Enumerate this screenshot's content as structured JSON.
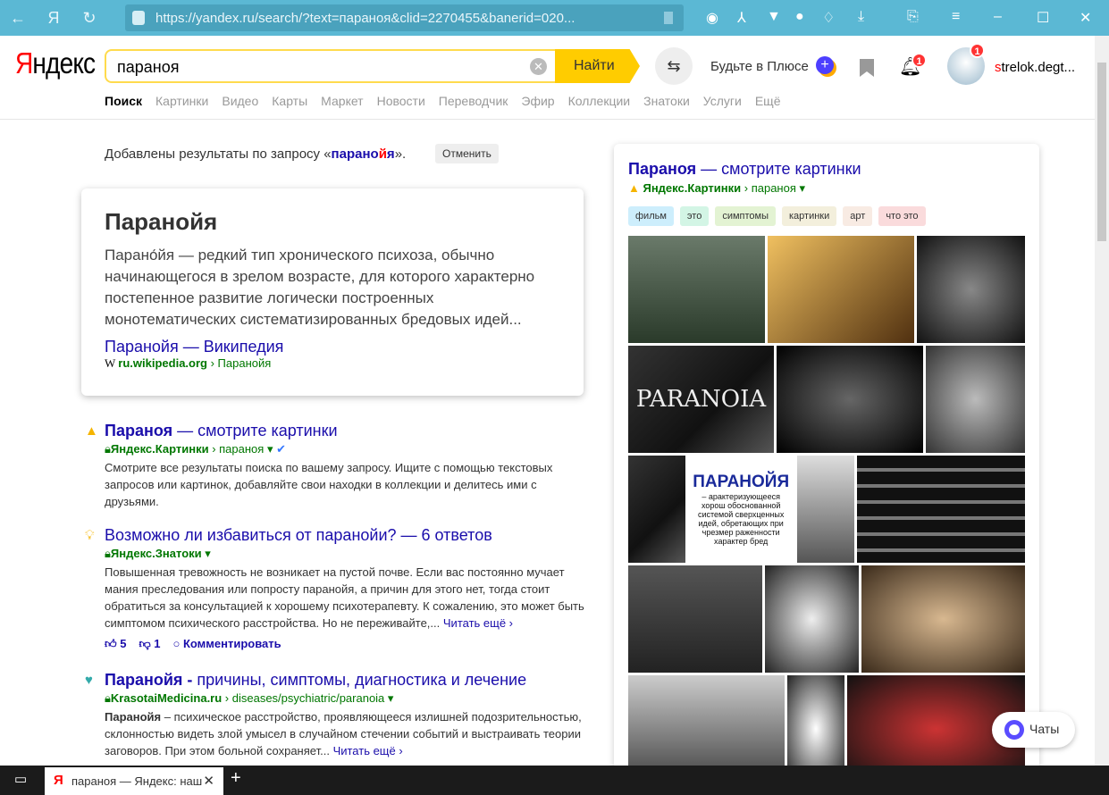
{
  "browser": {
    "url": "https://yandex.ru/search/?text=параноя&clid=2270455&banerid=020...",
    "tab_title": "параноя — Яндекс: наш"
  },
  "header": {
    "logo_first": "Я",
    "logo_rest": "ндекс",
    "query": "параноя",
    "find": "Найти",
    "plus": "Будьте в Плюсе",
    "notif_count": "1",
    "avatar_count": "1",
    "user_first": "s",
    "user_rest": "trelok.degt..."
  },
  "nav": [
    "Поиск",
    "Картинки",
    "Видео",
    "Карты",
    "Маркет",
    "Новости",
    "Переводчик",
    "Эфир",
    "Коллекции",
    "Знатоки",
    "Услуги",
    "Ещё"
  ],
  "notice": {
    "pre": "Добавлены результаты по запросу «",
    "q1": "парано",
    "q2": "й",
    "q3": "я",
    "post": "».",
    "cancel": "Отменить"
  },
  "wiki": {
    "title": "Паранойя",
    "text": "Парано́йя — редкий тип хронического психоза, обычно начинающегося в зрелом возрасте, для которого характерно постепенное развитие логически построенных монотематических систематизированных бредовых идей...",
    "link": "Паранойя — Википедия",
    "domain": "ru.wikipedia.org",
    "path": "Паранойя"
  },
  "results": [
    {
      "title_bold": "Параноя",
      "title": " — смотрите картинки",
      "site": "Яндекс.Картинки",
      "path": "параноя",
      "desc": "Смотрите все результаты поиска по вашему запросу. Ищите с помощью текстовых запросов или картинок, добавляйте свои находки в коллекции и делитесь ими с друзьями."
    },
    {
      "title": "Возможно ли избавиться от паранойи? — 6 ответов",
      "site": "Яндекс.Знатоки",
      "desc": "Повышенная тревожность не возникает на пустой почве. Если вас постоянно мучает мания преследования или попросту паранойя, а причин для этого нет, тогда стоит обратиться за консультацией к хорошему психотерапевту. К сожалению, это может быть симптомом психического расстройства. Но не переживайте,...",
      "more": "Читать ещё ›",
      "likes": "5",
      "dislikes": "1",
      "comment": "Комментировать"
    },
    {
      "title_bold": "Паранойя -",
      "title": " причины, симптомы, диагностика и лечение",
      "site": "KrasotaiMedicina.ru",
      "path": "diseases/psychiatric/paranoia",
      "desc_bold": "Паранойя",
      "desc": " – психическое расстройство, проявляющееся излишней подозрительностью, склонностью видеть злой умысел в случайном стечении событий и выстраивать теории заговоров. При этом больной сохраняет...",
      "more": "Читать ещё ›"
    }
  ],
  "images_panel": {
    "title_bold": "Параноя",
    "title": " — смотрите картинки",
    "site": "Яндекс.Картинки",
    "path": "параноя",
    "tags": [
      {
        "label": "фильм",
        "color": "#cdeefc"
      },
      {
        "label": "это",
        "color": "#d3f5e5"
      },
      {
        "label": "симптомы",
        "color": "#e3f3d3"
      },
      {
        "label": "картинки",
        "color": "#f3efdc"
      },
      {
        "label": "арт",
        "color": "#f8ebe3"
      },
      {
        "label": "что это",
        "color": "#fadbdc"
      }
    ],
    "img_text1": "PARANOIA",
    "img_text2": "ПАРАНОЙЯ",
    "img_text3": "– арактеризующееся хорош обоснованной системой сверхценных идей, обретающих при чрезмер раженности характер бред"
  },
  "chat": "Чаты"
}
